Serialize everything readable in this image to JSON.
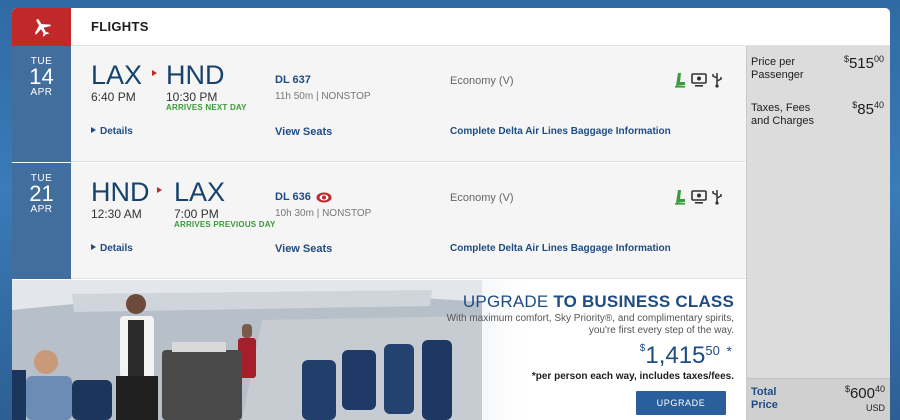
{
  "header": {
    "title": "FLIGHTS",
    "logo_icon": "plane-icon"
  },
  "flights": [
    {
      "date": {
        "dow": "TUE",
        "day": "14",
        "month": "APR"
      },
      "origin": "LAX",
      "destination": "HND",
      "depart": "6:40 PM",
      "arrive": "10:30 PM",
      "arrive_note": "ARRIVES NEXT DAY",
      "flight_number": "DL 637",
      "meta": "11h 50m | NONSTOP",
      "cabin": "Economy (V)",
      "details": "Details",
      "view_seats": "View Seats",
      "baggage": "Complete Delta Air Lines Baggage Information"
    },
    {
      "date": {
        "dow": "TUE",
        "day": "21",
        "month": "APR"
      },
      "origin": "HND",
      "destination": "LAX",
      "depart": "12:30 AM",
      "arrive": "7:00 PM",
      "arrive_note": "ARRIVES PREVIOUS DAY",
      "flight_number": "DL 636",
      "meta": "10h 30m | NONSTOP",
      "cabin": "Economy (V)",
      "details": "Details",
      "view_seats": "View Seats",
      "baggage": "Complete Delta Air Lines Baggage Information"
    }
  ],
  "pricing": {
    "per_passenger_label": "Price per Passenger",
    "per_passenger_sym": "$",
    "per_passenger_int": "515",
    "per_passenger_cents": "00",
    "taxes_label": "Taxes, Fees and Charges",
    "taxes_sym": "$",
    "taxes_int": "85",
    "taxes_cents": "40",
    "total_label": "Total Price",
    "total_sym": "$",
    "total_int": "600",
    "total_cents": "40",
    "currency": "USD"
  },
  "promo": {
    "title_a": "UPGRADE ",
    "title_b": "TO BUSINESS CLASS",
    "description": "With maximum comfort, Sky Priority®, and complimentary spirits, you're first every step of the way.",
    "price_sym": "$",
    "price_int": "1,415",
    "price_cents": "50",
    "price_ast": "*",
    "fine_print": "*per person each way, includes taxes/fees.",
    "button": "UPGRADE"
  },
  "colors": {
    "brand_red": "#c0282a",
    "navy": "#1f4c82",
    "date_blue": "#426e9e",
    "green": "#3a9b3a"
  }
}
